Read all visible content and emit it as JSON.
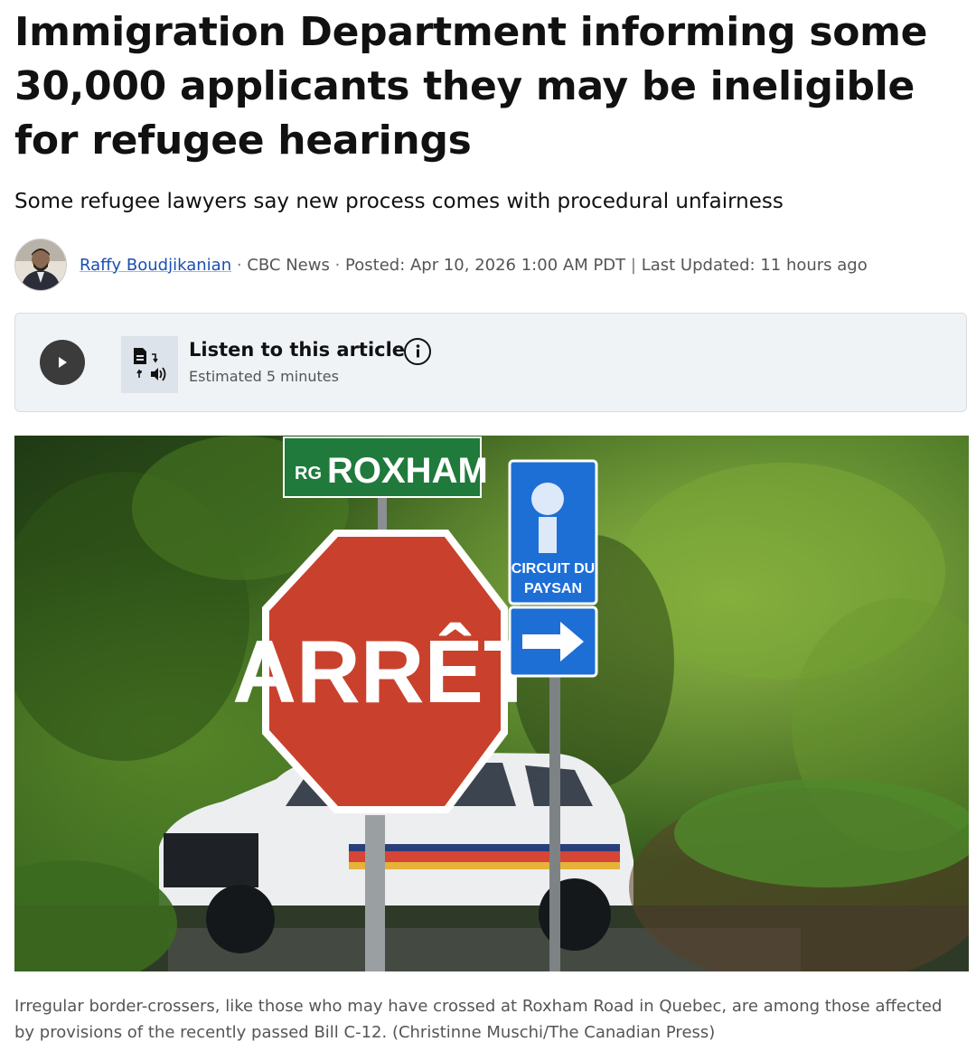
{
  "article": {
    "headline": "Immigration Department informing some 30,000 applicants they may be ineligible for refugee hearings",
    "deck": "Some refugee lawyers say new process comes with procedural unfairness"
  },
  "byline": {
    "author": "Raffy Boudjikanian",
    "separator": "·",
    "outlet": "CBC News",
    "posted": "Posted: Apr 10, 2026 1:00 AM PDT",
    "divider": "|",
    "updated": "Last Updated: 11 hours ago"
  },
  "listen": {
    "title": "Listen to this article",
    "duration": "Estimated 5 minutes"
  },
  "photo": {
    "street_sign": "ROXHAM",
    "street_sign_prefix": "RG",
    "stop_sign": "ARRÊT",
    "route_sign_line1": "CIRCUIT DU",
    "route_sign_line2": "PAYSAN"
  },
  "caption": "Irregular border-crossers, like those who may have crossed at Roxham Road in Quebec, are among those affected by provisions of the recently passed Bill C-12. (Christinne Muschi/The Canadian Press)",
  "colors": {
    "author_link": "#1a4fb3",
    "listen_panel": "#f0f3f6",
    "play_button": "#3b3b3b",
    "stop_sign": "#c9412c",
    "street_sign": "#1f7a3c",
    "route_sign": "#1d6fd6"
  },
  "icons": [
    "play-icon",
    "text-to-speech-icon",
    "info-icon"
  ]
}
